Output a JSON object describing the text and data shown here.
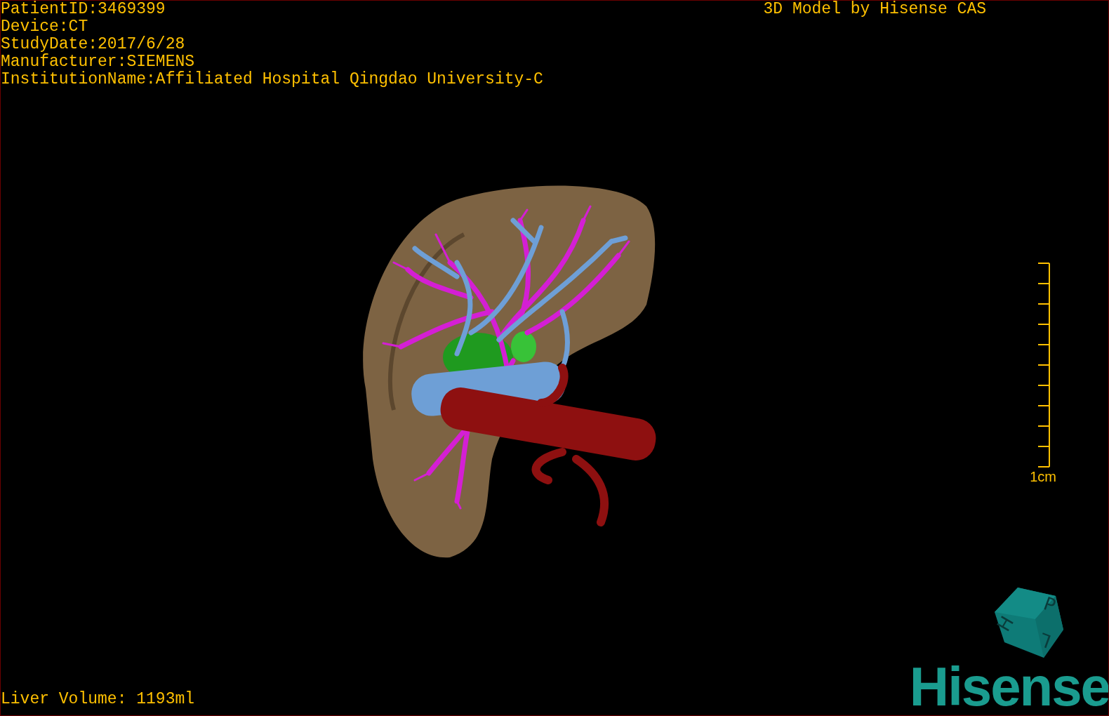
{
  "info_lines": [
    "PatientID:3469399",
    "Device:CT",
    "StudyDate:2017/6/28",
    "Manufacturer:SIEMENS",
    "InstitutionName:Affiliated Hospital Qingdao University-C"
  ],
  "caption": "3D Model by Hisense CAS",
  "scale_bar": {
    "label": "1cm"
  },
  "volume": "Liver Volume: 1193ml",
  "orientation_cube": {
    "faces": [
      "P",
      "H",
      "L"
    ]
  },
  "logo": "Hisense"
}
